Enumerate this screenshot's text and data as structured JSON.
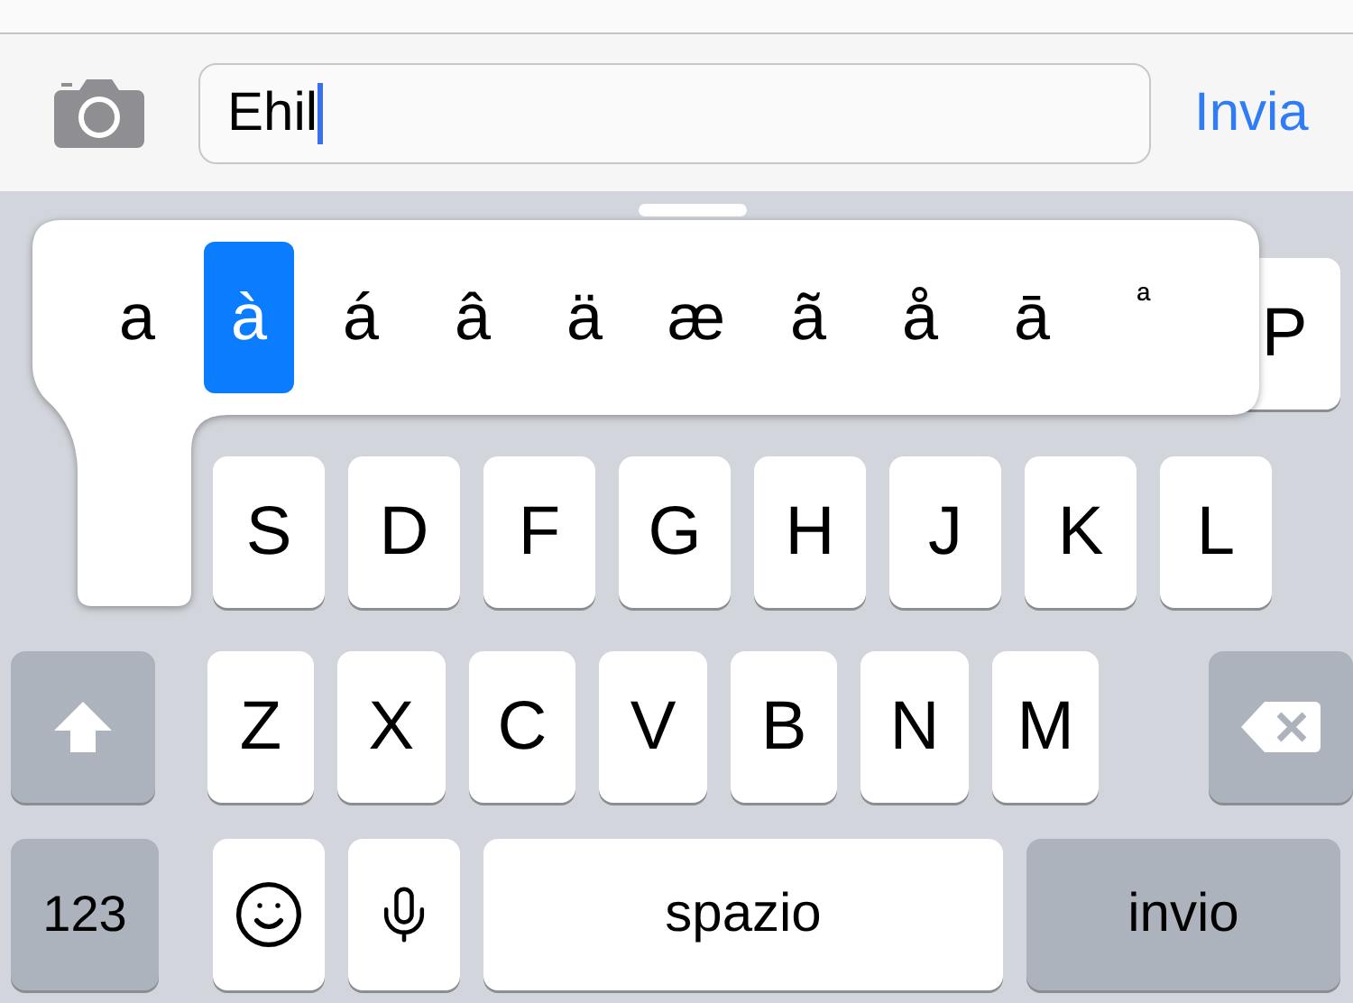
{
  "toolbar": {
    "message_field": {
      "value": "Ehil"
    },
    "send_button": "Invia"
  },
  "accent_popup": {
    "options": [
      {
        "label": "a",
        "selected": false
      },
      {
        "label": "à",
        "selected": true
      },
      {
        "label": "á",
        "selected": false
      },
      {
        "label": "â",
        "selected": false
      },
      {
        "label": "ä",
        "selected": false
      },
      {
        "label": "æ",
        "selected": false
      },
      {
        "label": "ã",
        "selected": false
      },
      {
        "label": "å",
        "selected": false
      },
      {
        "label": "ā",
        "selected": false
      },
      {
        "label": "ª",
        "selected": false
      }
    ]
  },
  "keyboard": {
    "rows": [
      {
        "keys": [
          {
            "kind": "letter",
            "label": "P"
          }
        ]
      },
      {
        "keys": [
          {
            "kind": "letter",
            "label": "S"
          },
          {
            "kind": "letter",
            "label": "D"
          },
          {
            "kind": "letter",
            "label": "F"
          },
          {
            "kind": "letter",
            "label": "G"
          },
          {
            "kind": "letter",
            "label": "H"
          },
          {
            "kind": "letter",
            "label": "J"
          },
          {
            "kind": "letter",
            "label": "K"
          },
          {
            "kind": "letter",
            "label": "L"
          }
        ]
      },
      {
        "keys": [
          {
            "kind": "shift"
          },
          {
            "kind": "letter",
            "label": "Z"
          },
          {
            "kind": "letter",
            "label": "X"
          },
          {
            "kind": "letter",
            "label": "C"
          },
          {
            "kind": "letter",
            "label": "V"
          },
          {
            "kind": "letter",
            "label": "B"
          },
          {
            "kind": "letter",
            "label": "N"
          },
          {
            "kind": "letter",
            "label": "M"
          },
          {
            "kind": "backspace"
          }
        ]
      },
      {
        "keys": [
          {
            "kind": "numbers",
            "label": "123"
          },
          {
            "kind": "emoji"
          },
          {
            "kind": "mic"
          },
          {
            "kind": "space",
            "label": "spazio"
          },
          {
            "kind": "return",
            "label": "invio"
          }
        ]
      }
    ]
  }
}
